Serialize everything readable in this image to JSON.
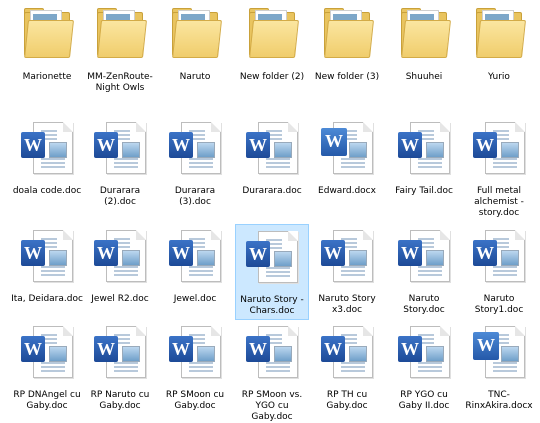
{
  "folders": [
    {
      "name": "Marionette",
      "icon": "folder-icon"
    },
    {
      "name": "MM-ZenRoute-Night Owls",
      "icon": "folder-icon"
    },
    {
      "name": "Naruto",
      "icon": "folder-icon"
    },
    {
      "name": "New folder (2)",
      "icon": "folder-icon"
    },
    {
      "name": "New folder (3)",
      "icon": "folder-icon"
    },
    {
      "name": "Shuuhei",
      "icon": "folder-icon"
    },
    {
      "name": "Yurio",
      "icon": "folder-icon"
    }
  ],
  "files_row1": [
    {
      "name": "doala code.doc"
    },
    {
      "name": "Durarara (2).doc"
    },
    {
      "name": "Durarara (3).doc"
    },
    {
      "name": "Durarara.doc"
    },
    {
      "name": "Edward.docx"
    },
    {
      "name": "Fairy Tail.doc"
    },
    {
      "name": "Full metal alchemist - story.doc"
    }
  ],
  "files_row2": [
    {
      "name": "Ita, Deidara.doc"
    },
    {
      "name": "Jewel R2.doc"
    },
    {
      "name": "Jewel.doc"
    },
    {
      "name": "Naruto Story - Chars.doc"
    },
    {
      "name": "Naruto Story x3.doc"
    },
    {
      "name": "Naruto Story.doc"
    },
    {
      "name": "Naruto Story1.doc"
    }
  ],
  "files_row3": [
    {
      "name": "RP DNAngel cu Gaby.doc"
    },
    {
      "name": "RP Naruto cu Gaby.doc"
    },
    {
      "name": "RP SMoon cu Gaby.doc"
    },
    {
      "name": "RP SMoon vs. YGO cu Gaby.doc"
    },
    {
      "name": "RP TH cu Gaby.doc"
    },
    {
      "name": "RP YGO cu Gaby II.doc"
    },
    {
      "name": "TNC-RinxAkira.docx"
    }
  ],
  "colors": {
    "selection": "#cce8ff",
    "folder": "#e9c45f",
    "word_blue": "#2b5797"
  },
  "selected_file": "Naruto Story - Chars.doc"
}
